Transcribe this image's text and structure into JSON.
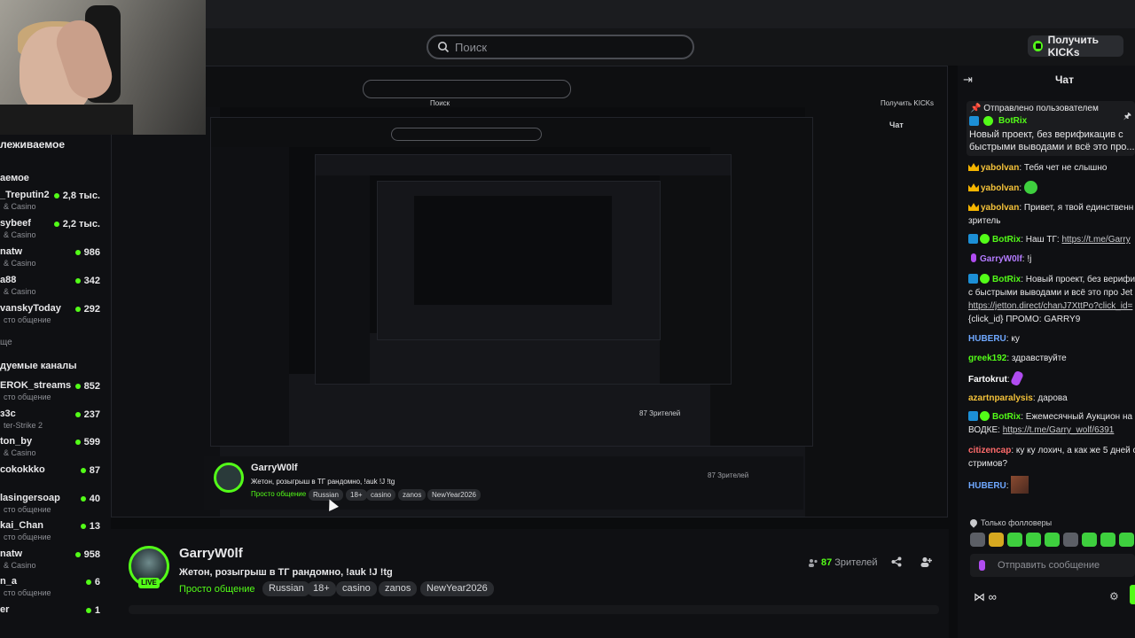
{
  "header": {
    "search_placeholder": "Поиск",
    "kicks_button": "Получить KICKs"
  },
  "sidebar": {
    "title": "леживаемое",
    "sub": "аемое",
    "items": [
      {
        "name": "_Treputin2",
        "category": "& Casino",
        "viewers": "2,8 тыс."
      },
      {
        "name": "sybeef",
        "category": "& Casino",
        "viewers": "2,2 тыс."
      },
      {
        "name": "natw",
        "category": "& Casino",
        "viewers": "986"
      },
      {
        "name": "a88",
        "category": "& Casino",
        "viewers": "342"
      },
      {
        "name": "vanskyToday",
        "category": "сто общение",
        "viewers": "292"
      }
    ],
    "more": "ще",
    "rec_title": "дуемые каналы",
    "rec_items": [
      {
        "name": "EROK_streams",
        "category": "сто общение",
        "viewers": "852"
      },
      {
        "name": "з3c",
        "category": "ter-Strike 2",
        "viewers": "237"
      },
      {
        "name": "ton_by",
        "category": "& Casino",
        "viewers": "599"
      },
      {
        "name": "cokokkko",
        "category": "",
        "viewers": "87"
      },
      {
        "name": "lasingersoap",
        "category": "сто общение",
        "viewers": "40"
      },
      {
        "name": "kai_Chan",
        "category": "сто общение",
        "viewers": "13"
      },
      {
        "name": "natw",
        "category": "& Casino",
        "viewers": "958"
      },
      {
        "name": "n_a",
        "category": "сто общение",
        "viewers": "6"
      },
      {
        "name": "er",
        "category": "",
        "viewers": "1"
      }
    ]
  },
  "stream": {
    "streamer": "GarryW0lf",
    "live_badge": "LIVE",
    "title": "Жетон, розыгрыш в ТГ рандомно,  !auk !J !tg",
    "category": "Просто общение",
    "tags": [
      "Russian",
      "18+",
      "casino",
      "zanos",
      "NewYear2026"
    ],
    "viewers_count": "87",
    "viewers_label": "Зрителей"
  },
  "chat": {
    "title": "Чат",
    "pinned_header": "Отправлено пользователем",
    "pinned_user": "BotRix",
    "pinned_message": "Новый проект, без верификацив с быстрыми выводами и всё это про...",
    "messages": [
      {
        "user": "yabolvan",
        "text": ": Тебя чет не слышно"
      },
      {
        "user": "yabolvan",
        "text": ":"
      },
      {
        "user": "yabolvan",
        "text": ": Привет, я твой единственн"
      },
      {
        "user": "",
        "text": "зритель"
      },
      {
        "user": "BotRix",
        "text": ": Наш ТГ: ",
        "link": "https://t.me/Garry"
      },
      {
        "user": "GarryW0lf",
        "text": ": !j"
      },
      {
        "user": "BotRix",
        "text": ": Новый проект, без верифи"
      },
      {
        "user": "",
        "text": "с быстрыми выводами и всё это про Jet"
      },
      {
        "user": "",
        "text": "",
        "link": "https://jetton.direct/chanJ7XttPo?click_id="
      },
      {
        "user": "",
        "text": "{click_id} ПРОМО: GARRY9"
      },
      {
        "user": "HUBERU",
        "text": ": ку"
      },
      {
        "user": "greek192",
        "text": ": здравствуйте"
      },
      {
        "user": "Fartokrut",
        "text": ":"
      },
      {
        "user": "azartnparalysis",
        "text": ": дарова"
      },
      {
        "user": "BotRix",
        "text": ": Ежемесячный Аукцион на"
      },
      {
        "user": "",
        "text": "ВОДКЕ: ",
        "link": "https://t.me/Garry_wolf/6391"
      },
      {
        "user": "citizencap",
        "text": ": ку ку лохич, а как же 5 дней с"
      },
      {
        "user": "",
        "text": "стримов?"
      },
      {
        "user": "HUBERU",
        "text": ":"
      }
    ],
    "followers_only": "Только фолловеры",
    "input_placeholder": "Отправить сообщение",
    "footer": "∞"
  },
  "nested": {
    "chat_title": "Чат",
    "search_placeholder": "Поиск",
    "kicks_button": "Получить KICKs",
    "viewers": "87 Зрителей"
  },
  "colors": {
    "accent": "#53fc18",
    "background": "#0b0c0e",
    "panel": "#0f1013"
  }
}
